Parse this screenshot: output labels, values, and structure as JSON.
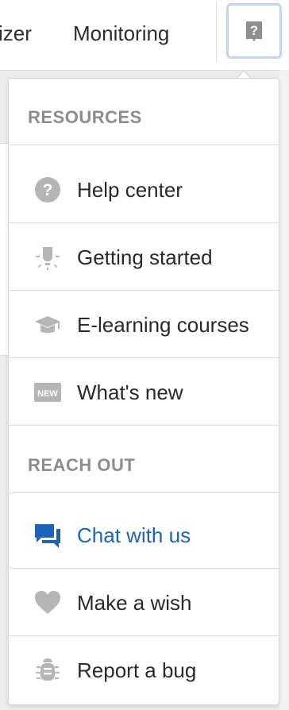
{
  "nav": {
    "items": [
      {
        "label": "izer"
      },
      {
        "label": "Monitoring"
      }
    ]
  },
  "help_button": {
    "icon": "question-square-icon"
  },
  "dropdown": {
    "sections": [
      {
        "title": "RESOURCES",
        "items": [
          {
            "label": "Help center",
            "icon": "question-circle-icon"
          },
          {
            "label": "Getting started",
            "icon": "lightbulb-icon"
          },
          {
            "label": "E-learning courses",
            "icon": "graduation-cap-icon"
          },
          {
            "label": "What's new",
            "icon": "new-badge-icon",
            "badge_text": "NEW"
          }
        ]
      },
      {
        "title": "REACH OUT",
        "items": [
          {
            "label": "Chat with us",
            "icon": "chat-icon",
            "color": "#1f63b8"
          },
          {
            "label": "Make a wish",
            "icon": "heart-icon"
          },
          {
            "label": "Report a bug",
            "icon": "bug-icon"
          }
        ]
      }
    ]
  },
  "colors": {
    "accent": "#1f63b8",
    "icon_gray": "#b5b5b5",
    "section_title": "#8c8c8c"
  }
}
